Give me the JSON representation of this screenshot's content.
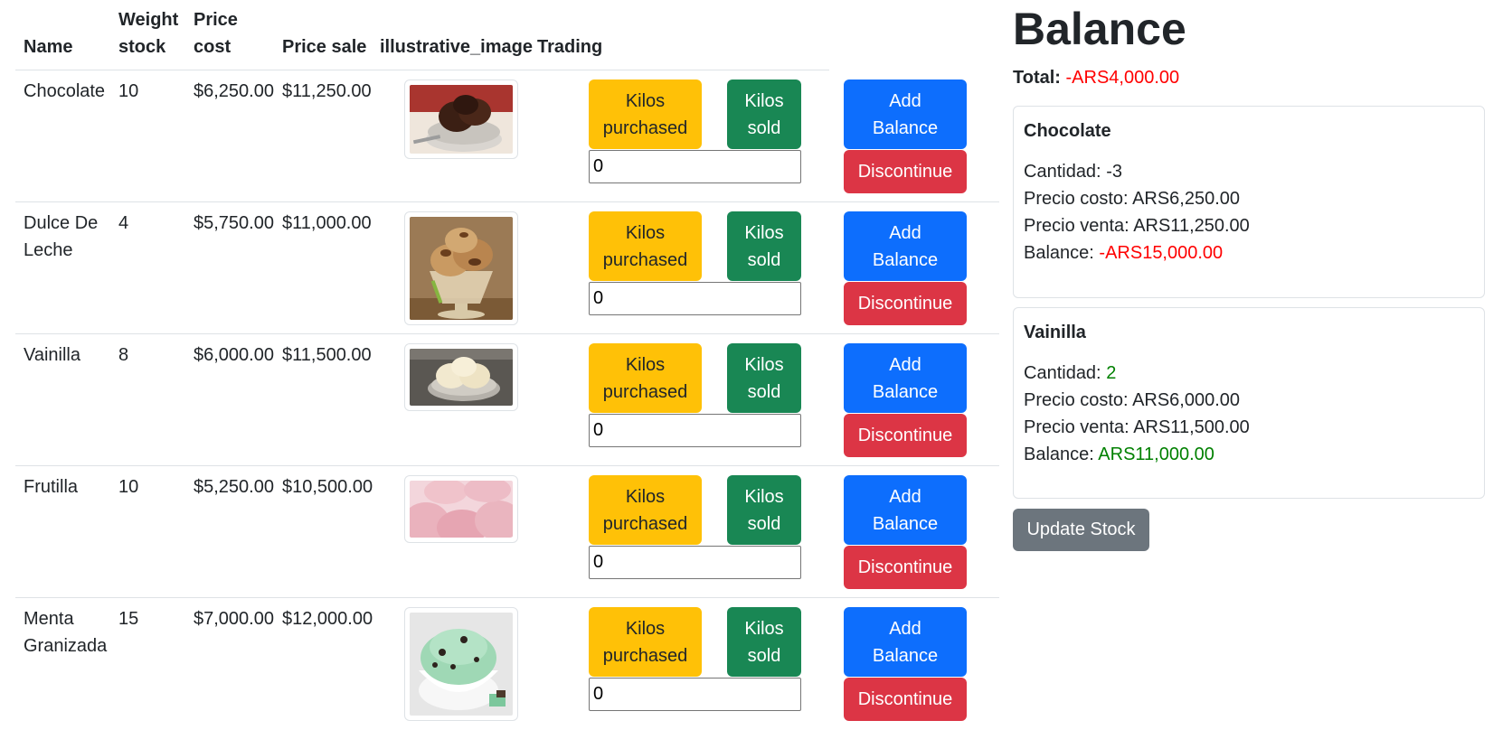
{
  "table": {
    "headers": {
      "name": "Name",
      "weight_line1": "Weight",
      "weight_line2": "stock",
      "cost_line1": "Price",
      "cost_line2": "cost",
      "sale": "Price sale",
      "image": "illustrative_image",
      "trading": "Trading"
    },
    "button_labels": {
      "purchased_line1": "Kilos",
      "purchased_line2": "purchased",
      "sold_line1": "Kilos",
      "sold_line2": "sold",
      "add_line1": "Add",
      "add_line2": "Balance",
      "discontinue": "Discontinue"
    },
    "rows": [
      {
        "name_line1": "Chocolate",
        "name_line2": "",
        "stock": "10",
        "cost": "$6,250.00",
        "sale": "$11,250.00",
        "qty": "0",
        "image": "chocolate-ice-cream"
      },
      {
        "name_line1": "Dulce De",
        "name_line2": "Leche",
        "stock": "4",
        "cost": "$5,750.00",
        "sale": "$11,000.00",
        "qty": "0",
        "image": "dulce-de-leche-ice-cream"
      },
      {
        "name_line1": "Vainilla",
        "name_line2": "",
        "stock": "8",
        "cost": "$6,000.00",
        "sale": "$11,500.00",
        "qty": "0",
        "image": "vanilla-ice-cream"
      },
      {
        "name_line1": "Frutilla",
        "name_line2": "",
        "stock": "10",
        "cost": "$5,250.00",
        "sale": "$10,500.00",
        "qty": "0",
        "image": "strawberry-ice-cream"
      },
      {
        "name_line1": "Menta",
        "name_line2": "Granizada",
        "stock": "15",
        "cost": "$7,000.00",
        "sale": "$12,000.00",
        "qty": "0",
        "image": "mint-chip-ice-cream"
      }
    ]
  },
  "balance": {
    "title": "Balance",
    "total_label": "Total:",
    "total_value": "-ARS4,000.00",
    "total_color": "#ff0000",
    "labels": {
      "cantidad": "Cantidad:",
      "precio_costo": "Precio costo:",
      "precio_venta": "Precio venta:",
      "balance": "Balance:"
    },
    "cards": [
      {
        "title": "Chocolate",
        "cantidad": "-3",
        "precio_costo": "ARS6,250.00",
        "precio_venta": "ARS11,250.00",
        "balance": "-ARS15,000.00",
        "balance_color": "#ff0000"
      },
      {
        "title": "Vainilla",
        "cantidad": "2",
        "precio_costo": "ARS6,000.00",
        "precio_venta": "ARS11,500.00",
        "balance": "ARS11,000.00",
        "balance_color": "#008000"
      }
    ],
    "update_button": "Update Stock"
  },
  "colors": {
    "warning": "#ffc107",
    "success": "#198754",
    "primary": "#0d6efd",
    "danger": "#dc3545",
    "secondary": "#6c757d"
  }
}
